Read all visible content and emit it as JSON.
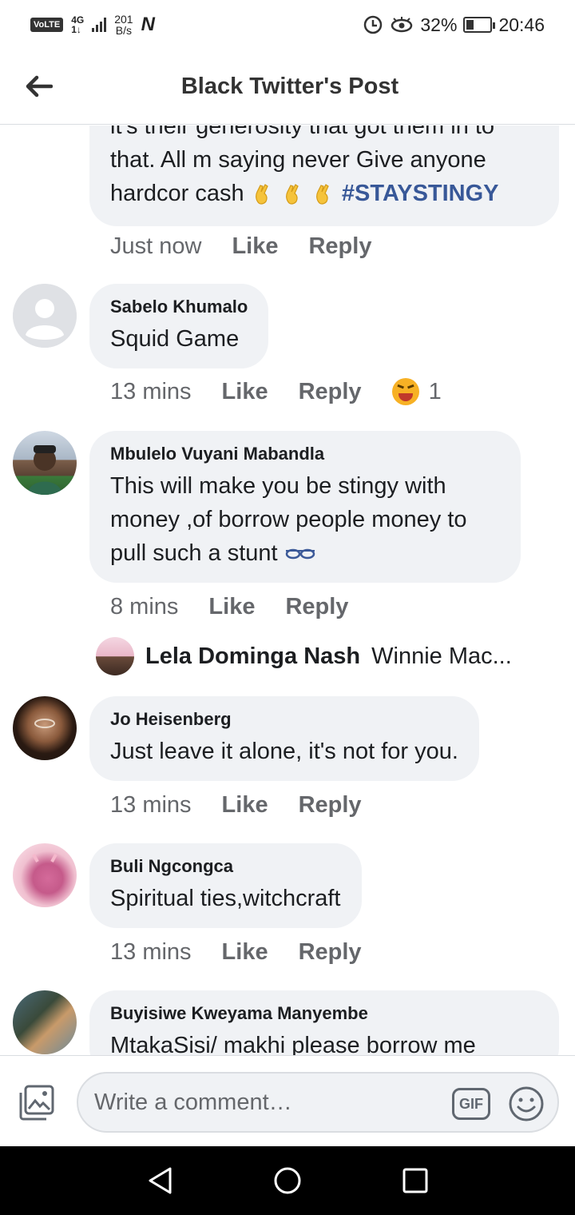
{
  "status_bar": {
    "volte": "VoLTE",
    "network": "4G",
    "network_sub": "1↓",
    "speed_value": "201",
    "speed_unit": "B/s",
    "battery": "32%",
    "battery_level": 0.32,
    "time": "20:46"
  },
  "header": {
    "title": "Black Twitter's Post"
  },
  "comments": [
    {
      "text_cut": "it's their generosity that got them in to",
      "text_line2": "that. All m saying never Give anyone",
      "text_line3": "hardcor cash",
      "hashtag": "#STAYSTINGY",
      "time": "Just now",
      "like": "Like",
      "reply": "Reply"
    },
    {
      "author": "Sabelo Khumalo",
      "text": "Squid Game",
      "time": "13 mins",
      "like": "Like",
      "reply": "Reply",
      "reaction_count": "1"
    },
    {
      "author": "Mbulelo Vuyani Mabandla",
      "text_line1": "This will make you be stingy with",
      "text_line2": "money ,of borrow people money to",
      "text_line3": "pull such a stunt",
      "time": "8 mins",
      "like": "Like",
      "reply": "Reply"
    },
    {
      "author": "Jo Heisenberg",
      "text": "Just leave it alone, it's not for you.",
      "time": "13 mins",
      "like": "Like",
      "reply": "Reply"
    },
    {
      "author": "Buli Ngcongca",
      "text": "Spiritual ties,witchcraft",
      "time": "13 mins",
      "like": "Like",
      "reply": "Reply"
    },
    {
      "author": "Buyisiwe Kweyama Manyembe",
      "text": "MtakaSisi/ makhi please borrow me"
    }
  ],
  "reply_preview": {
    "name": "Lela Dominga Nash",
    "text": "Winnie Mac..."
  },
  "composer": {
    "placeholder": "Write a comment…",
    "gif_label": "GIF"
  }
}
